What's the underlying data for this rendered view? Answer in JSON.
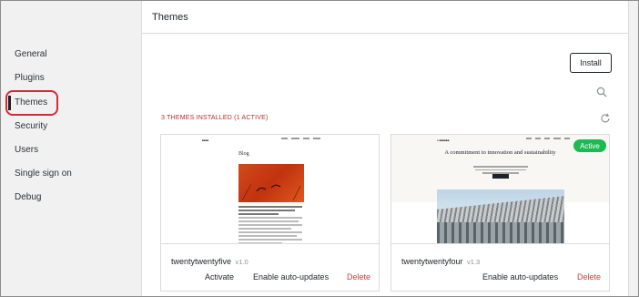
{
  "sidebar": {
    "items": [
      {
        "label": "General"
      },
      {
        "label": "Plugins"
      },
      {
        "label": "Themes"
      },
      {
        "label": "Security"
      },
      {
        "label": "Users"
      },
      {
        "label": "Single sign on"
      },
      {
        "label": "Debug"
      }
    ],
    "active_index": 2
  },
  "header": {
    "title": "Themes"
  },
  "toolbar": {
    "install_label": "Install",
    "search_icon": "search-icon",
    "refresh_icon": "refresh-icon"
  },
  "installed_summary": "3 THEMES INSTALLED (1 ACTIVE)",
  "themes": [
    {
      "name": "twentytwentyfive",
      "version": "v1.0",
      "active": false,
      "actions": {
        "activate": "Activate",
        "auto_updates": "Enable auto-updates",
        "delete": "Delete"
      },
      "preview": {
        "blog_title": "Blog"
      }
    },
    {
      "name": "twentytwentyfour",
      "version": "v1.3",
      "active": true,
      "badge": "Active",
      "actions": {
        "auto_updates": "Enable auto-updates",
        "delete": "Delete"
      },
      "preview": {
        "headline": "A commitment to innovation and sustainability"
      }
    }
  ],
  "colors": {
    "delete": "#d63638",
    "active_badge": "#1db954",
    "highlight_ring": "#d42a36",
    "summary_text": "#b32d2e"
  }
}
